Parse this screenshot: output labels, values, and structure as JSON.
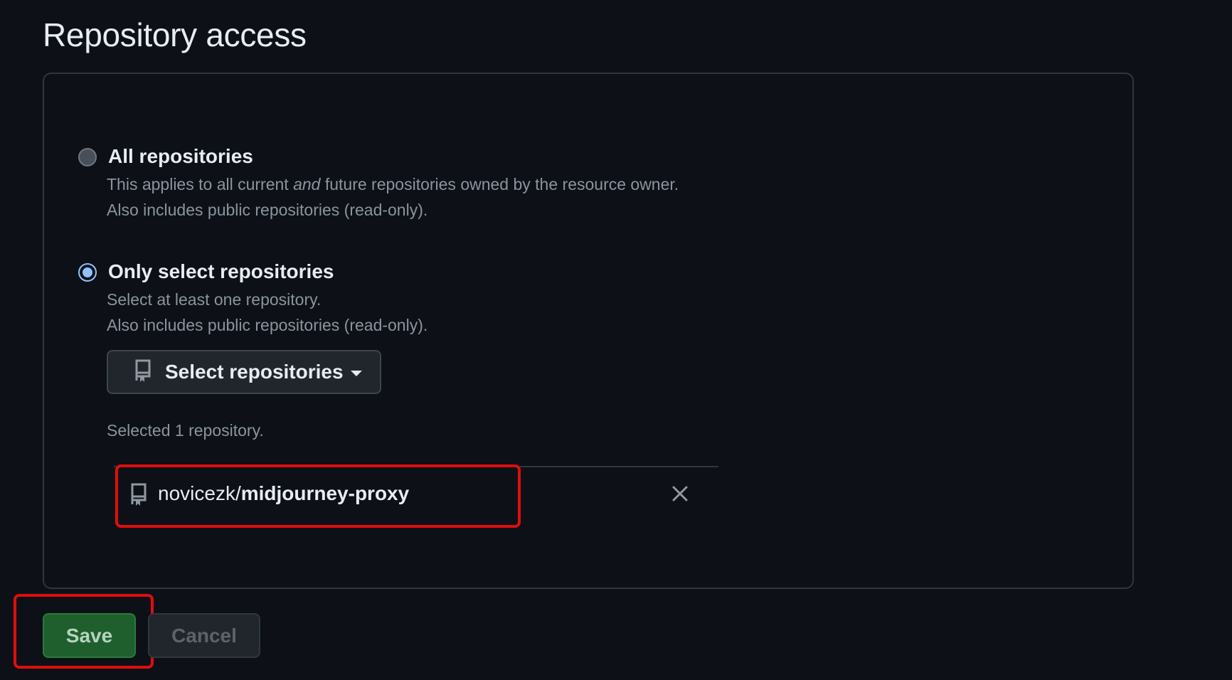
{
  "section": {
    "title": "Repository access"
  },
  "options": [
    {
      "label": "All repositories",
      "selected": false,
      "desc_line1_pre": "This applies to all current ",
      "desc_line1_em": "and",
      "desc_line1_post": " future repositories owned by the resource owner.",
      "desc_line2": "Also includes public repositories (read-only)."
    },
    {
      "label": "Only select repositories",
      "selected": true,
      "desc_line1": "Select at least one repository.",
      "desc_line2": "Also includes public repositories (read-only)."
    }
  ],
  "select_button": {
    "label": "Select repositories",
    "icon": "repo-icon"
  },
  "selected_count_text": "Selected 1 repository.",
  "selected_repos": [
    {
      "owner": "novicezk/",
      "name": "midjourney-proxy",
      "icon": "repo-icon",
      "remove_icon": "close-icon"
    }
  ],
  "actions": {
    "save_label": "Save",
    "cancel_label": "Cancel"
  },
  "colors": {
    "background": "#0d1117",
    "accent_radio": "#8fc1ff",
    "save_green": "#1f5f2d",
    "highlight_red": "#e00d0d"
  }
}
